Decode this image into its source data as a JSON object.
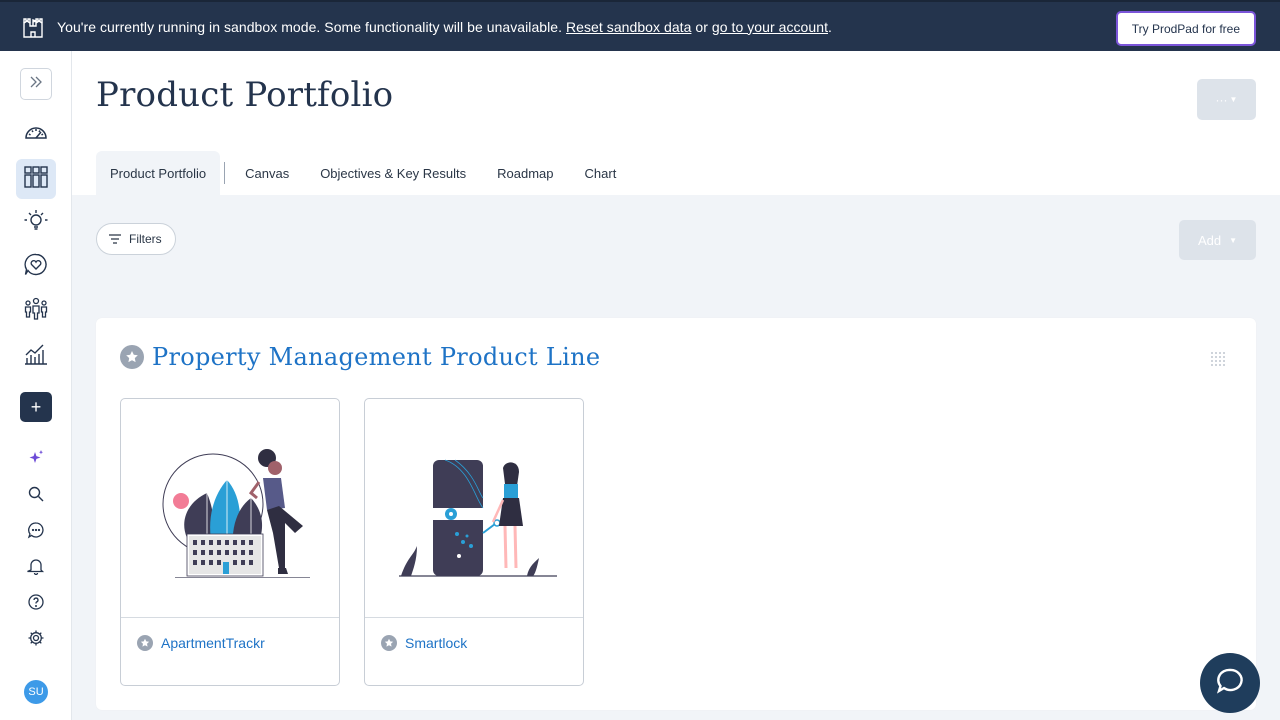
{
  "banner": {
    "text": "You're currently running in sandbox mode. Some functionality will be unavailable.",
    "reset_link": "Reset sandbox data",
    "or_text": "or",
    "account_link": "go to your account",
    "period": ".",
    "try_button": "Try ProdPad for free"
  },
  "sidebar": {
    "avatar_initials": "SU",
    "items": [
      {
        "icon": "dashboard-gauge-icon"
      },
      {
        "icon": "product-portfolio-grid-icon",
        "active": true
      },
      {
        "icon": "ideas-lightbulb-icon"
      },
      {
        "icon": "feedback-heart-icon"
      },
      {
        "icon": "customers-people-icon"
      },
      {
        "icon": "reports-chart-icon"
      }
    ],
    "add_label": "+"
  },
  "header": {
    "title": "Product Portfolio",
    "more_label": "···"
  },
  "tabs": [
    {
      "label": "Product Portfolio",
      "active": true
    },
    {
      "label": "Canvas"
    },
    {
      "label": "Objectives & Key Results"
    },
    {
      "label": "Roadmap"
    },
    {
      "label": "Chart"
    }
  ],
  "toolbar": {
    "filters_label": "Filters",
    "add_label": "Add"
  },
  "product_line": {
    "title": "Property Management Product Line",
    "products": [
      {
        "name": "ApartmentTrackr"
      },
      {
        "name": "Smartlock"
      }
    ]
  },
  "colors": {
    "banner_bg": "#24344d",
    "accent_blue": "#1e73c6",
    "main_bg": "#f1f4f8",
    "try_border": "#7b55d9"
  }
}
